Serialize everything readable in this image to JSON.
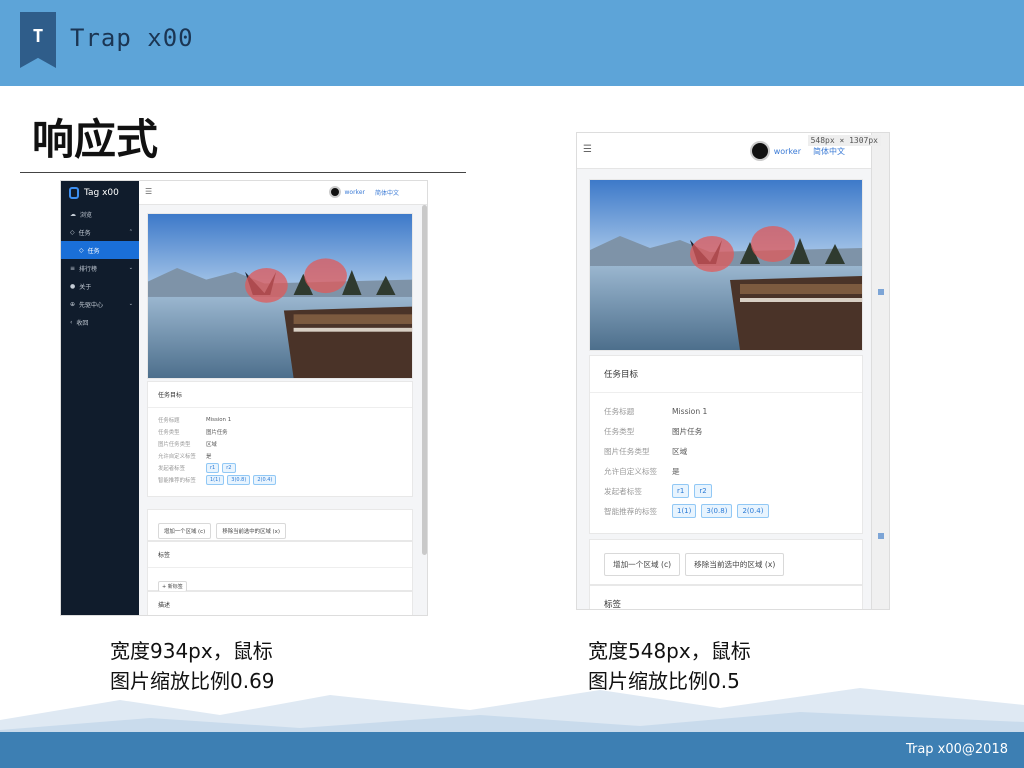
{
  "slide": {
    "brand_letter": "T",
    "brand_name": "Trap x00",
    "title": "响应式",
    "footer": "Trap x00@2018"
  },
  "captions": {
    "left": [
      "宽度934px，鼠标",
      "图片缩放比例0.69"
    ],
    "right": [
      "宽度548px，鼠标",
      "图片缩放比例0.5"
    ]
  },
  "left_screenshot": {
    "app_name": "Tag x00",
    "sidebar": [
      {
        "label": "浏览",
        "icon": "cloud-icon"
      },
      {
        "label": "任务",
        "icon": "tag-icon",
        "caret": "⌃"
      },
      {
        "label": "任务",
        "icon": "tag-icon",
        "sub": true
      },
      {
        "label": "排行榜",
        "icon": "list-icon",
        "caret": "⌄"
      },
      {
        "label": "关于",
        "icon": "info-icon"
      },
      {
        "label": "先驱中心",
        "icon": "compass-icon",
        "caret": "⌄"
      },
      {
        "label": "收回",
        "icon": "chevron-left-icon"
      }
    ],
    "user": "worker",
    "lang": "简体中文",
    "section_target": "任务目标",
    "fields": [
      {
        "key": "任务标题",
        "val": "Mission 1"
      },
      {
        "key": "任务类型",
        "val": "图片任务"
      },
      {
        "key": "图片任务类型",
        "val": "区域"
      },
      {
        "key": "允许自定义标签",
        "val": "是"
      }
    ],
    "publisher_tags_key": "发起者标签",
    "publisher_tags": [
      "r1",
      "r2"
    ],
    "smart_tags_key": "智能推荐的标签",
    "smart_tags": [
      "1(1)",
      "3(0.8)",
      "2(0.4)"
    ],
    "buttons": [
      "增加一个区域 (c)",
      "移除当前选中的区域 (x)"
    ],
    "section_tags": "标签",
    "add_tag": "+ 新标签",
    "section_desc": "描述"
  },
  "right_screenshot": {
    "dimension_label": "548px × 1307px",
    "user": "worker",
    "lang": "简体中文",
    "section_target": "任务目标",
    "fields": [
      {
        "key": "任务标题",
        "val": "Mission 1"
      },
      {
        "key": "任务类型",
        "val": "图片任务"
      },
      {
        "key": "图片任务类型",
        "val": "区域"
      },
      {
        "key": "允许自定义标签",
        "val": "是"
      }
    ],
    "publisher_tags_key": "发起者标签",
    "publisher_tags": [
      "r1",
      "r2"
    ],
    "smart_tags_key": "智能推荐的标签",
    "smart_tags": [
      "1(1)",
      "3(0.8)",
      "2(0.4)"
    ],
    "buttons": [
      "增加一个区域 (c)",
      "移除当前选中的区域 (x)"
    ],
    "section_tags": "标签"
  },
  "colors": {
    "header": "#5da4d8",
    "sidebar": "#101c2c",
    "accent": "#1a6fd8",
    "region_mark": "#e05a5a"
  }
}
